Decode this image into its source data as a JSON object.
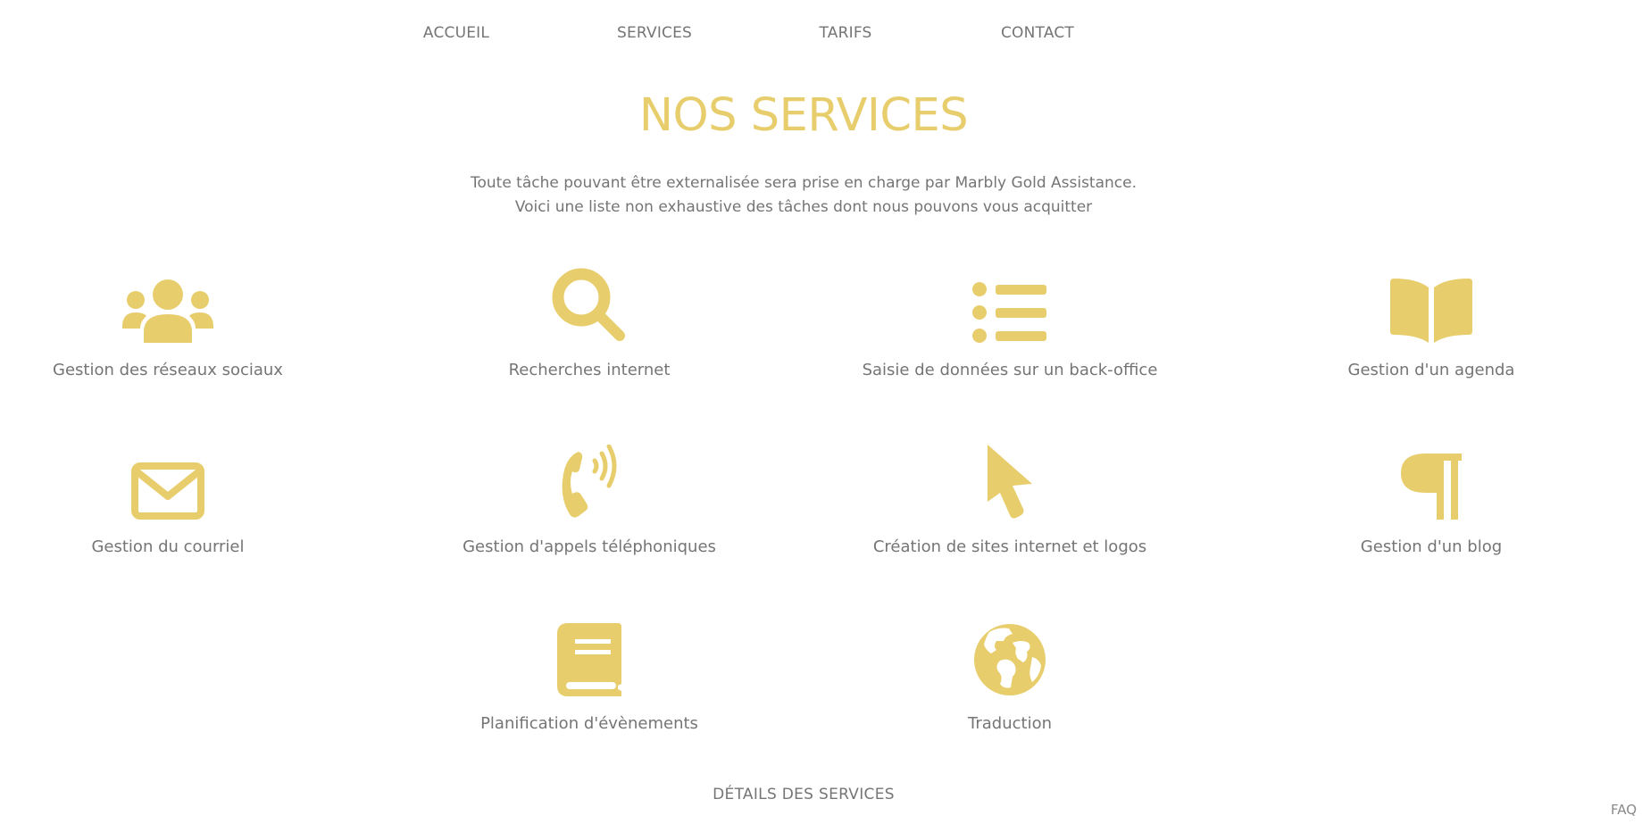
{
  "nav": {
    "items": [
      {
        "label": "ACCUEIL"
      },
      {
        "label": "SERVICES"
      },
      {
        "label": "TARIFS"
      },
      {
        "label": "CONTACT"
      }
    ]
  },
  "main": {
    "title": "NOS SERVICES",
    "intro_line1": "Toute tâche pouvant être externalisée sera prise en charge par Marbly Gold Assistance.",
    "intro_line2": "Voici une liste non exhaustive des tâches dont nous pouvons vous acquitter",
    "accent_color": "#e8cd6c",
    "services": [
      {
        "label": "Gestion des réseaux sociaux",
        "icon": "users-icon"
      },
      {
        "label": "Recherches internet",
        "icon": "search-icon"
      },
      {
        "label": "Saisie de données sur un back-office",
        "icon": "list-icon"
      },
      {
        "label": "Gestion d'un agenda",
        "icon": "book-open-icon"
      },
      {
        "label": "Gestion du courriel",
        "icon": "envelope-icon"
      },
      {
        "label": "Gestion d'appels téléphoniques",
        "icon": "phone-volume-icon"
      },
      {
        "label": "Création de sites internet et logos",
        "icon": "mouse-pointer-icon"
      },
      {
        "label": "Gestion d'un blog",
        "icon": "paragraph-icon"
      },
      {
        "label": "Planification d'évènements",
        "icon": "book-icon"
      },
      {
        "label": "Traduction",
        "icon": "globe-icon"
      }
    ],
    "details_link": "DÉTAILS DES SERVICES"
  },
  "footer": {
    "faq": "FAQ"
  }
}
